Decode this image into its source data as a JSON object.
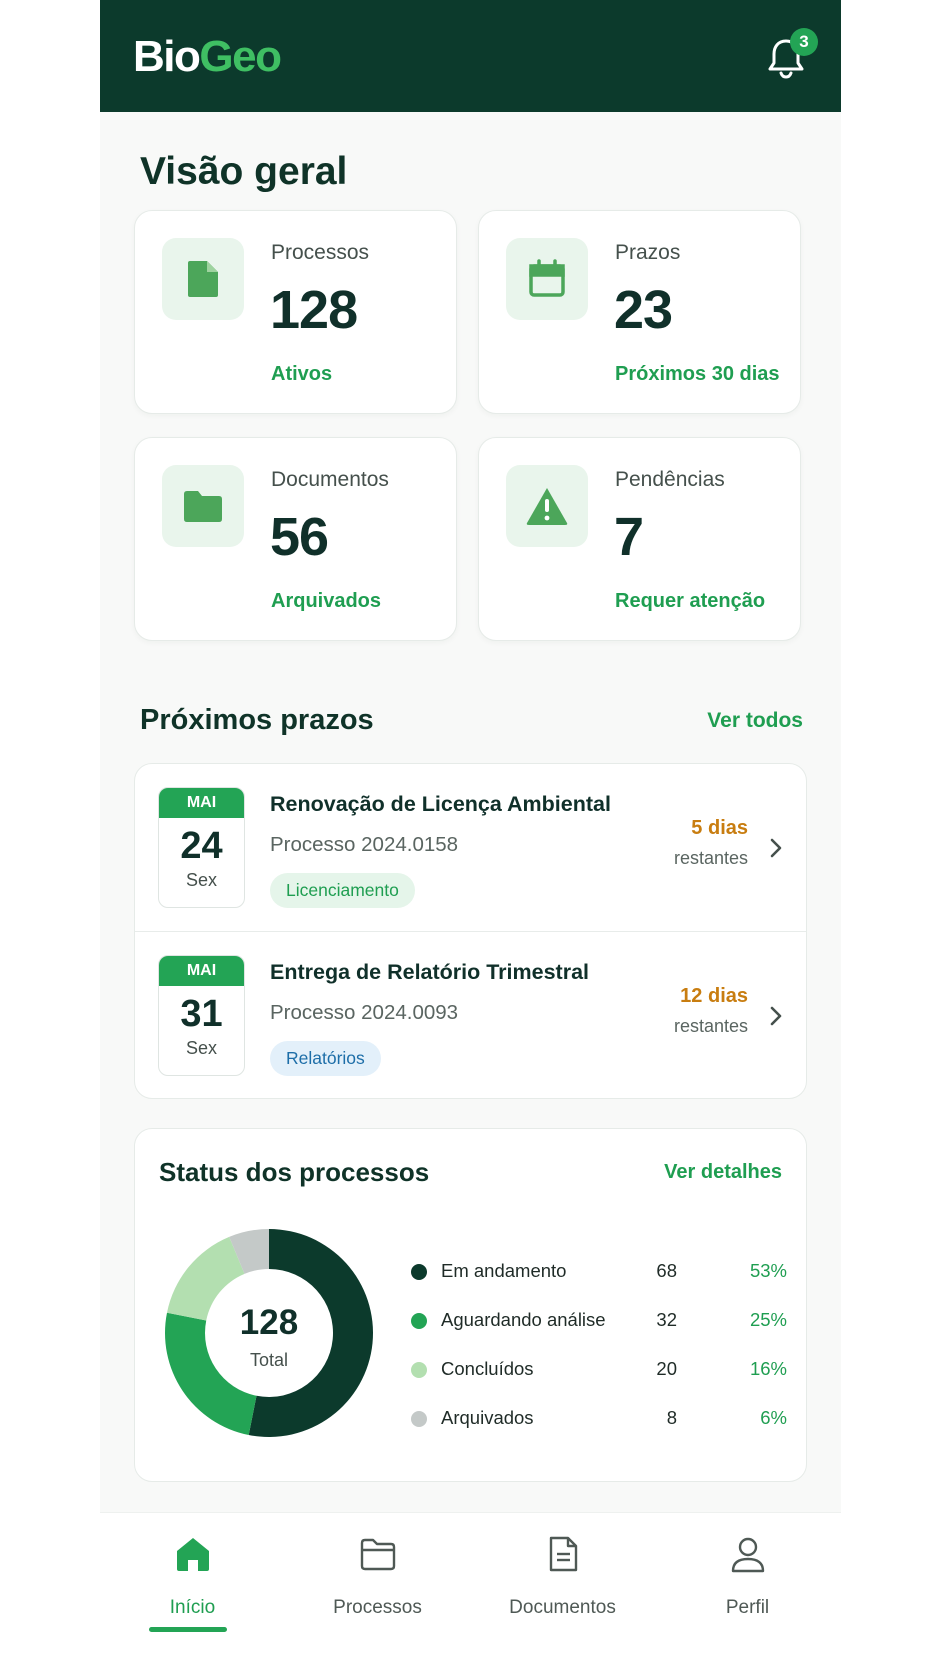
{
  "header": {
    "logo_part1": "Bio",
    "logo_part2": "Geo",
    "notification_count": "3"
  },
  "overview": {
    "title": "Visão geral",
    "cards": [
      {
        "label": "Processos",
        "value": "128",
        "sub": "Ativos",
        "icon": "document-icon"
      },
      {
        "label": "Prazos",
        "value": "23",
        "sub": "Próximos 30 dias",
        "icon": "calendar-icon"
      },
      {
        "label": "Documentos",
        "value": "56",
        "sub": "Arquivados",
        "icon": "folder-icon"
      },
      {
        "label": "Pendências",
        "value": "7",
        "sub": "Requer atenção",
        "icon": "warning-icon"
      }
    ]
  },
  "deadlines": {
    "title": "Próximos prazos",
    "link": "Ver todos",
    "items": [
      {
        "month": "MAI",
        "day": "24",
        "weekday": "Sex",
        "title": "Renovação de Licença Ambiental",
        "process": "Processo 2024.0158",
        "tag": "Licenciamento",
        "days": "5 dias",
        "remaining": "restantes"
      },
      {
        "month": "MAI",
        "day": "31",
        "weekday": "Sex",
        "title": "Entrega de Relatório Trimestral",
        "process": "Processo 2024.0093",
        "tag": "Relatórios",
        "days": "12 dias",
        "remaining": "restantes"
      }
    ]
  },
  "status": {
    "title": "Status dos processos",
    "link": "Ver detalhes",
    "total_value": "128",
    "total_label": "Total",
    "items": [
      {
        "label": "Em andamento",
        "count": "68",
        "pct": "53%",
        "value": 68,
        "color": "#0c3a2c"
      },
      {
        "label": "Aguardando análise",
        "count": "32",
        "pct": "25%",
        "value": 32,
        "color": "#23a455"
      },
      {
        "label": "Concluídos",
        "count": "20",
        "pct": "16%",
        "value": 20,
        "color": "#b3dfb0"
      },
      {
        "label": "Arquivados",
        "count": "8",
        "pct": "6%",
        "value": 8,
        "color": "#c4c9c8"
      }
    ]
  },
  "nav": {
    "items": [
      {
        "label": "Início",
        "icon": "home-icon"
      },
      {
        "label": "Processos",
        "icon": "folder-icon"
      },
      {
        "label": "Documentos",
        "icon": "document-icon"
      },
      {
        "label": "Perfil",
        "icon": "user-icon"
      }
    ]
  },
  "colors": {
    "header_bg": "#0c3a2c",
    "accent": "#23a455",
    "warning_text": "#c87d10"
  }
}
